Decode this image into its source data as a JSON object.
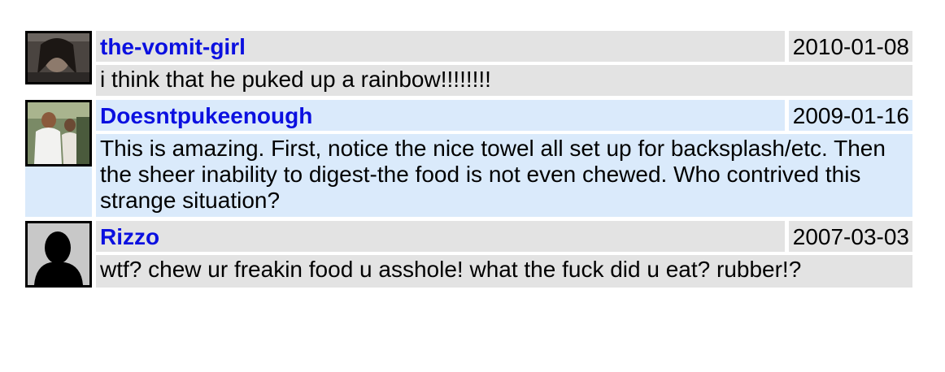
{
  "comments": [
    {
      "author": "the-vomit-girl",
      "date": "2010-01-08",
      "text": "i think that he puked up a rainbow!!!!!!!!",
      "theme": "gray"
    },
    {
      "author": "Doesntpukeenough",
      "date": "2009-01-16",
      "text": "This is amazing. First, notice the nice towel all set up for backsplash/etc. Then the sheer inability to digest-the food is not even chewed. Who contrived this strange situation?",
      "theme": "blue"
    },
    {
      "author": "Rizzo",
      "date": "2007-03-03",
      "text": "wtf? chew ur freakin food u asshole! what the fuck did u eat? rubber!?",
      "theme": "gray"
    }
  ],
  "colors": {
    "link": "#0b10e0",
    "gray_row": "#e3e3e3",
    "blue_row": "#daeafb"
  }
}
